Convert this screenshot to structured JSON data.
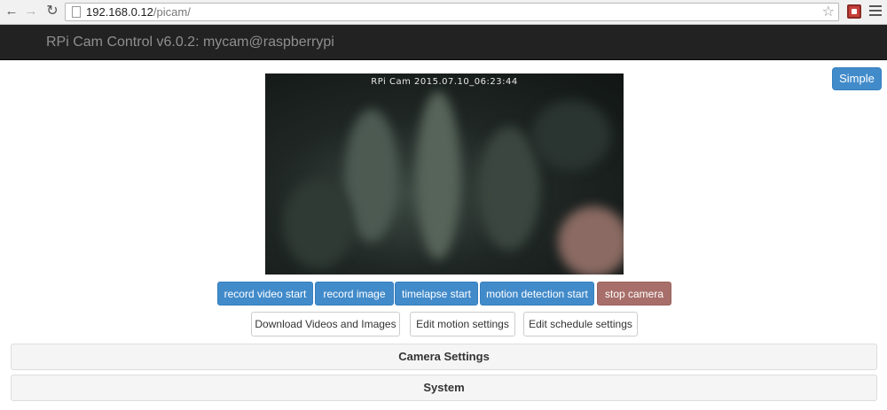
{
  "browser": {
    "url_host": "192.168.0.12",
    "url_path": "/picam/",
    "icons": [
      "back-icon",
      "forward-icon",
      "reload-icon",
      "page-icon",
      "star-icon",
      "extension-icon",
      "menu-icon"
    ]
  },
  "navbar": {
    "brand": "RPi Cam Control v6.0.2: mycam@raspberrypi"
  },
  "simple_button": "Simple",
  "preview": {
    "overlay_text": "RPi Cam  2015.07.10_06:23:44"
  },
  "actions": [
    {
      "label": "record video start"
    },
    {
      "label": "record image"
    },
    {
      "label": "timelapse start"
    },
    {
      "label": "motion detection start"
    },
    {
      "label": "stop camera"
    }
  ],
  "secondary_actions": [
    {
      "label": "Download Videos and Images"
    },
    {
      "label": "Edit motion settings"
    },
    {
      "label": "Edit schedule settings"
    }
  ],
  "panels": [
    {
      "title": "Camera Settings"
    },
    {
      "title": "System"
    }
  ],
  "colors": {
    "primary": "#428bca",
    "danger": "#a86f6a",
    "navbar": "#222222"
  }
}
